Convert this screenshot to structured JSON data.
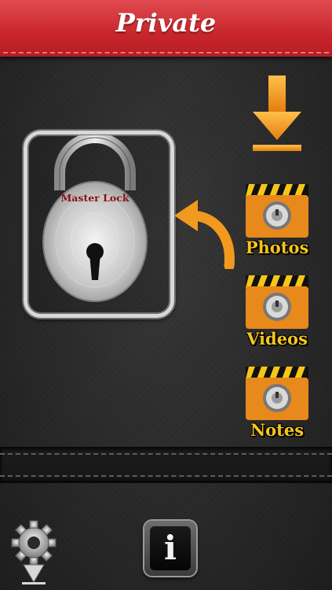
{
  "header": {
    "title": "Private"
  },
  "lock": {
    "brand_label": "Master Lock"
  },
  "folders": [
    {
      "label": "Photos"
    },
    {
      "label": "Videos"
    },
    {
      "label": "Notes"
    }
  ],
  "info_button": {
    "glyph": "i"
  },
  "colors": {
    "header_red": "#c8262c",
    "accent_orange": "#f29a1e",
    "folder_label_yellow": "#f5c61a",
    "lock_text": "#8a1010"
  },
  "icons": {
    "download": "download-arrow-icon",
    "lock": "padlock-icon",
    "curve": "curved-arrow-icon",
    "folder": "safe-folder-icon",
    "settings": "gear-icon",
    "info": "info-icon"
  }
}
